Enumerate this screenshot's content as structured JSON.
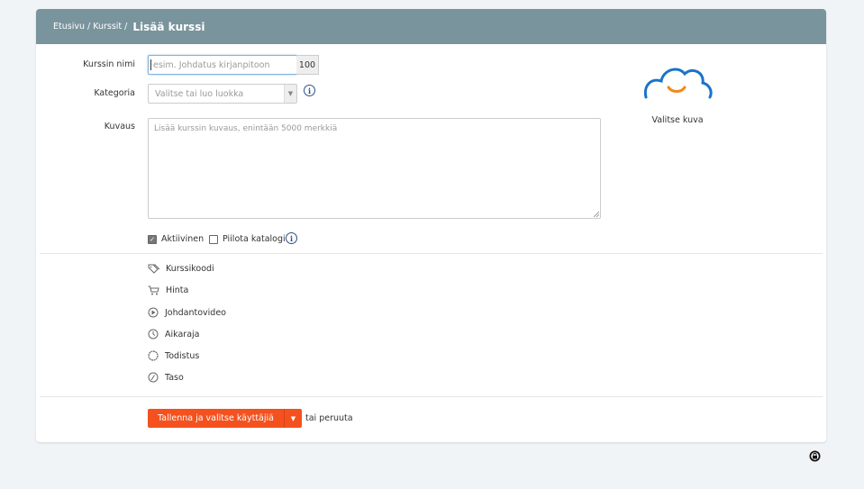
{
  "breadcrumb": {
    "home": "Etusivu",
    "separator": "/",
    "courses": "Kurssit",
    "current": "Lisää kurssi"
  },
  "form": {
    "course_name_label": "Kurssin nimi",
    "course_name_placeholder": "esim. Johdatus kirjanpitoon",
    "course_name_counter": "100",
    "category_label": "Kategoria",
    "category_placeholder": "Valitse tai luo luokka",
    "description_label": "Kuvaus",
    "description_placeholder": "Lisää kurssin kuvaus, enintään 5000 merkkiä",
    "active_label": "Aktiivinen",
    "active_checked": true,
    "hide_catalog_label": "Piilota katalogi",
    "hide_catalog_checked": false,
    "info_glyph": "i"
  },
  "image_picker": {
    "label": "Valitse kuva",
    "icon": "cloud-smile-icon"
  },
  "options": [
    {
      "label": "Kurssikoodi",
      "icon": "tag-icon"
    },
    {
      "label": "Hinta",
      "icon": "cart-icon"
    },
    {
      "label": "Johdantovideo",
      "icon": "play-icon"
    },
    {
      "label": "Aikaraja",
      "icon": "clock-icon"
    },
    {
      "label": "Todistus",
      "icon": "certificate-icon"
    },
    {
      "label": "Taso",
      "icon": "gauge-icon"
    }
  ],
  "actions": {
    "save_label": "Tallenna ja valitse käyttäjiä",
    "dropdown_glyph": "▼",
    "cancel_text": "tai peruuta"
  },
  "colors": {
    "header_bg": "#7a949d",
    "primary_button": "#f4511e",
    "cloud_blue": "#1a73c8",
    "smile_orange": "#f08a1a"
  }
}
